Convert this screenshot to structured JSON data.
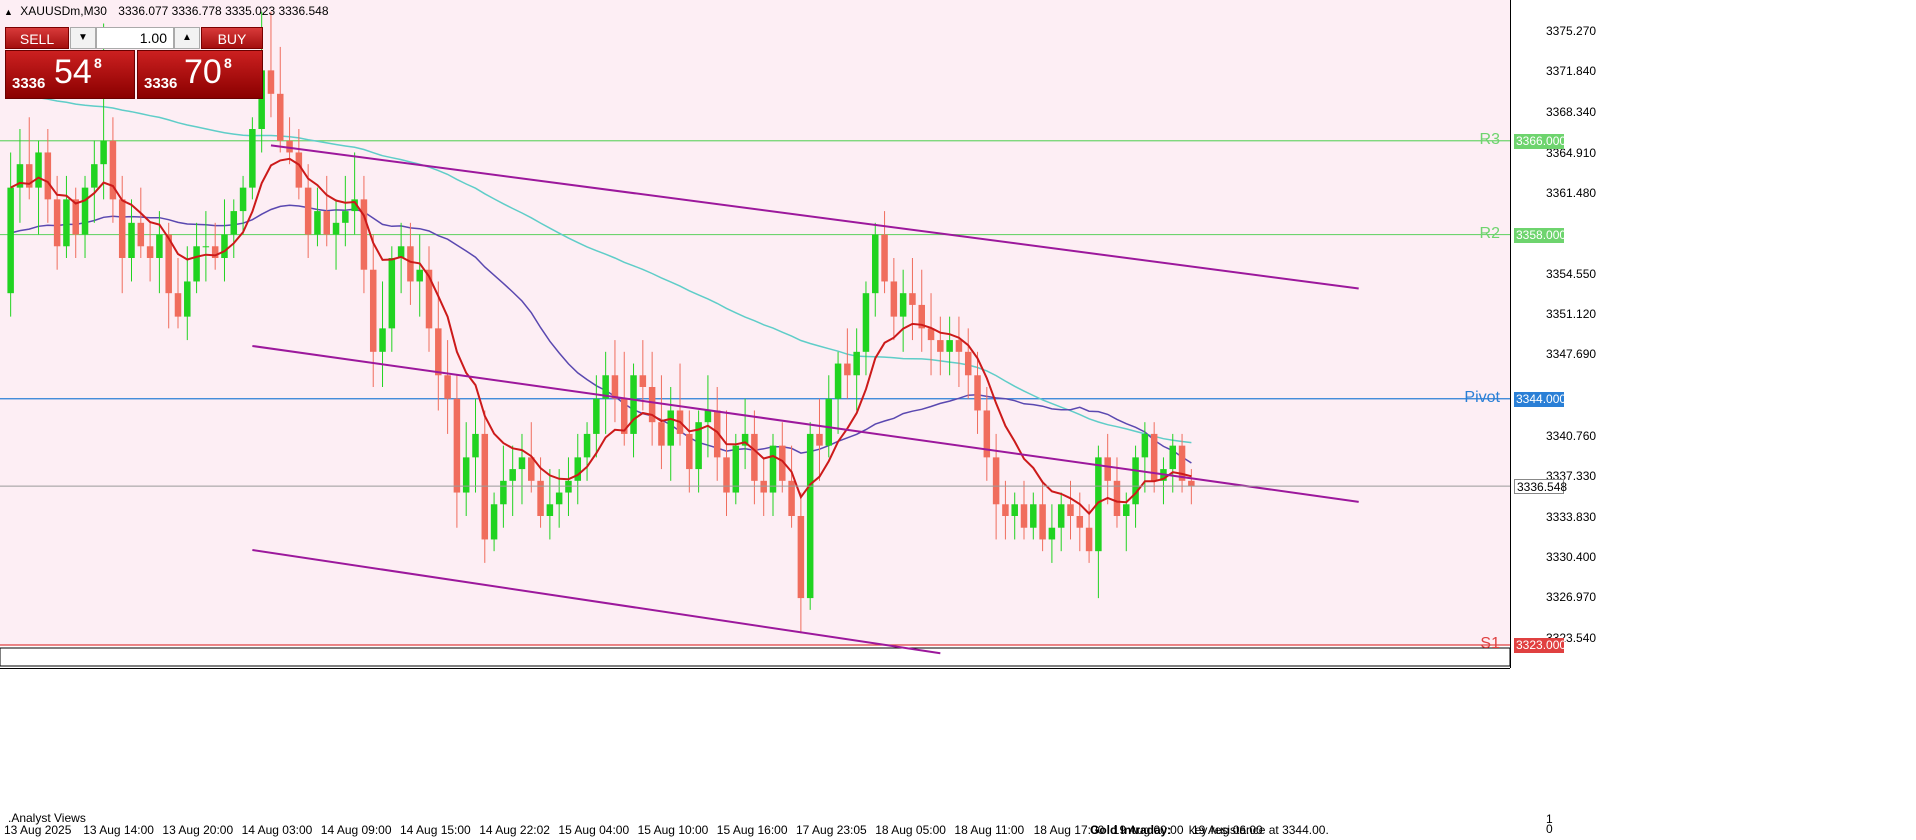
{
  "window": {
    "title": "XAUUSDm,M30",
    "ohlc": "3336.077 3336.778 3335.023 3336.548"
  },
  "trade_panel": {
    "sell_label": "SELL",
    "buy_label": "BUY",
    "lot_value": "1.00",
    "dec_symbol": "▼",
    "inc_symbol": "▲",
    "sell_price": {
      "prefix": "3336",
      "big": "54",
      "sup": "8"
    },
    "buy_price": {
      "prefix": "3336",
      "big": "70",
      "sup": "8"
    }
  },
  "colors": {
    "background": "#fdeef4",
    "bull": "#21d321",
    "bear": "#f06d5d",
    "ema_fast": "#cc1a1a",
    "ma_mid": "#5a48b0",
    "ma_slow": "#5fcdc8",
    "channel": "#9c189c",
    "resistance": "#6ed46e",
    "pivot": "#2a7fd6",
    "support": "#e04040"
  },
  "chart_data": {
    "type": "candlestick",
    "symbol": "XAUUSDm",
    "timeframe": "M30",
    "y_range": [
      3323.0,
      3378.0
    ],
    "y_ticks": [
      "3375.270",
      "3371.840",
      "3368.340",
      "3364.910",
      "3361.480",
      "3354.550",
      "3351.120",
      "3347.690",
      "3340.760",
      "3337.330",
      "3333.830",
      "3330.400",
      "3326.970",
      "3323.540"
    ],
    "x_ticks": [
      "13 Aug 2025",
      "13 Aug 14:00",
      "13 Aug 20:00",
      "14 Aug 03:00",
      "14 Aug 09:00",
      "14 Aug 15:00",
      "14 Aug 22:02",
      "15 Aug 04:00",
      "15 Aug 10:00",
      "15 Aug 16:00",
      "17 Aug 23:05",
      "18 Aug 05:00",
      "18 Aug 11:00",
      "18 Aug 17:00",
      "19 Aug 00:00",
      "19 Aug 06:00"
    ],
    "current_price": "3336.548",
    "levels": [
      {
        "name": "R3",
        "value": 3366.0,
        "label": "3366.000",
        "kind": "resistance"
      },
      {
        "name": "R2",
        "value": 3358.0,
        "label": "3358.000",
        "kind": "resistance"
      },
      {
        "name": "Pivot",
        "value": 3344.0,
        "label": "3344.000",
        "kind": "pivot"
      },
      {
        "name": "S1",
        "value": 3323.0,
        "label": "3323.000",
        "kind": "support"
      }
    ],
    "candles": [
      [
        3353,
        3365,
        3351,
        3362
      ],
      [
        3362,
        3367,
        3359,
        3364
      ],
      [
        3364,
        3368,
        3361,
        3362
      ],
      [
        3362,
        3366,
        3358,
        3365
      ],
      [
        3365,
        3367,
        3359,
        3361
      ],
      [
        3361,
        3363,
        3355,
        3357
      ],
      [
        3357,
        3363,
        3356,
        3361
      ],
      [
        3361,
        3362,
        3356,
        3358
      ],
      [
        3358,
        3363,
        3356,
        3362
      ],
      [
        3362,
        3366,
        3359,
        3364
      ],
      [
        3364,
        3376,
        3361,
        3366
      ],
      [
        3366,
        3368,
        3359,
        3361
      ],
      [
        3361,
        3363,
        3353,
        3356
      ],
      [
        3356,
        3361,
        3354,
        3359
      ],
      [
        3359,
        3362,
        3356,
        3357
      ],
      [
        3357,
        3359,
        3354,
        3356
      ],
      [
        3356,
        3360,
        3353,
        3358
      ],
      [
        3358,
        3359,
        3350,
        3353
      ],
      [
        3353,
        3356,
        3350,
        3351
      ],
      [
        3351,
        3357,
        3349,
        3354
      ],
      [
        3354,
        3359,
        3353,
        3357
      ],
      [
        3357,
        3360,
        3354,
        3357
      ],
      [
        3357,
        3359,
        3355,
        3356
      ],
      [
        3356,
        3361,
        3354,
        3358
      ],
      [
        3358,
        3361,
        3356,
        3360
      ],
      [
        3360,
        3363,
        3358,
        3362
      ],
      [
        3362,
        3368,
        3361,
        3367
      ],
      [
        3367,
        3377,
        3365,
        3372
      ],
      [
        3372,
        3377,
        3368,
        3370
      ],
      [
        3370,
        3374,
        3365,
        3366
      ],
      [
        3366,
        3368,
        3364,
        3365
      ],
      [
        3365,
        3367,
        3361,
        3362
      ],
      [
        3362,
        3364,
        3356,
        3358
      ],
      [
        3358,
        3362,
        3357,
        3360
      ],
      [
        3360,
        3363,
        3357,
        3358
      ],
      [
        3358,
        3361,
        3355,
        3359
      ],
      [
        3359,
        3363,
        3357,
        3360
      ],
      [
        3360,
        3365,
        3358,
        3361
      ],
      [
        3361,
        3363,
        3353,
        3355
      ],
      [
        3355,
        3358,
        3345,
        3348
      ],
      [
        3348,
        3354,
        3345,
        3350
      ],
      [
        3350,
        3357,
        3348,
        3356
      ],
      [
        3356,
        3359,
        3353,
        3357
      ],
      [
        3357,
        3359,
        3352,
        3354
      ],
      [
        3354,
        3358,
        3351,
        3355
      ],
      [
        3355,
        3357,
        3348,
        3350
      ],
      [
        3350,
        3354,
        3343,
        3346
      ],
      [
        3346,
        3349,
        3341,
        3344
      ],
      [
        3344,
        3346,
        3333,
        3336
      ],
      [
        3336,
        3342,
        3334,
        3339
      ],
      [
        3339,
        3344,
        3336,
        3341
      ],
      [
        3341,
        3343,
        3330,
        3332
      ],
      [
        3332,
        3336,
        3331,
        3335
      ],
      [
        3335,
        3340,
        3333,
        3337
      ],
      [
        3337,
        3340,
        3334,
        3338
      ],
      [
        3338,
        3341,
        3335,
        3339
      ],
      [
        3339,
        3342,
        3336,
        3337
      ],
      [
        3337,
        3339,
        3333,
        3334
      ],
      [
        3334,
        3338,
        3332,
        3335
      ],
      [
        3335,
        3338,
        3333,
        3336
      ],
      [
        3336,
        3339,
        3334,
        3337
      ],
      [
        3337,
        3341,
        3335,
        3339
      ],
      [
        3339,
        3342,
        3337,
        3341
      ],
      [
        3341,
        3346,
        3339,
        3344
      ],
      [
        3344,
        3348,
        3341,
        3346
      ],
      [
        3346,
        3349,
        3342,
        3344
      ],
      [
        3344,
        3348,
        3340,
        3341
      ],
      [
        3341,
        3347,
        3339,
        3346
      ],
      [
        3346,
        3349,
        3343,
        3345
      ],
      [
        3345,
        3348,
        3340,
        3342
      ],
      [
        3342,
        3346,
        3338,
        3340
      ],
      [
        3340,
        3345,
        3337,
        3343
      ],
      [
        3343,
        3347,
        3340,
        3341
      ],
      [
        3341,
        3343,
        3336,
        3338
      ],
      [
        3338,
        3343,
        3336,
        3342
      ],
      [
        3342,
        3346,
        3339,
        3343
      ],
      [
        3343,
        3345,
        3337,
        3339
      ],
      [
        3339,
        3343,
        3334,
        3336
      ],
      [
        3336,
        3341,
        3335,
        3340
      ],
      [
        3340,
        3344,
        3338,
        3341
      ],
      [
        3341,
        3343,
        3335,
        3337
      ],
      [
        3337,
        3339,
        3334,
        3336
      ],
      [
        3336,
        3341,
        3334,
        3340
      ],
      [
        3340,
        3342,
        3336,
        3337
      ],
      [
        3337,
        3340,
        3333,
        3334
      ],
      [
        3334,
        3336,
        3324,
        3327
      ],
      [
        3327,
        3342,
        3326,
        3341
      ],
      [
        3341,
        3344,
        3337,
        3340
      ],
      [
        3340,
        3346,
        3339,
        3344
      ],
      [
        3344,
        3348,
        3341,
        3347
      ],
      [
        3347,
        3350,
        3344,
        3346
      ],
      [
        3346,
        3350,
        3343,
        3348
      ],
      [
        3348,
        3354,
        3346,
        3353
      ],
      [
        3353,
        3359,
        3351,
        3358
      ],
      [
        3358,
        3360,
        3353,
        3354
      ],
      [
        3354,
        3356,
        3349,
        3351
      ],
      [
        3351,
        3355,
        3348,
        3353
      ],
      [
        3353,
        3356,
        3349,
        3352
      ],
      [
        3352,
        3355,
        3348,
        3350
      ],
      [
        3350,
        3353,
        3346,
        3349
      ],
      [
        3349,
        3351,
        3346,
        3348
      ],
      [
        3348,
        3351,
        3346,
        3349
      ],
      [
        3349,
        3351,
        3345,
        3348
      ],
      [
        3348,
        3350,
        3344,
        3346
      ],
      [
        3346,
        3348,
        3341,
        3343
      ],
      [
        3343,
        3345,
        3337,
        3339
      ],
      [
        3339,
        3341,
        3332,
        3335
      ],
      [
        3335,
        3337,
        3332,
        3334
      ],
      [
        3334,
        3336,
        3332,
        3335
      ],
      [
        3335,
        3337,
        3332,
        3333
      ],
      [
        3333,
        3336,
        3332,
        3335
      ],
      [
        3335,
        3337,
        3331,
        3332
      ],
      [
        3332,
        3335,
        3330,
        3333
      ],
      [
        3333,
        3336,
        3331,
        3335
      ],
      [
        3335,
        3337,
        3332,
        3334
      ],
      [
        3334,
        3336,
        3331,
        3333
      ],
      [
        3333,
        3335,
        3330,
        3331
      ],
      [
        3331,
        3340,
        3327,
        3339
      ],
      [
        3339,
        3341,
        3335,
        3337
      ],
      [
        3337,
        3339,
        3333,
        3334
      ],
      [
        3334,
        3336,
        3331,
        3335
      ],
      [
        3335,
        3340,
        3333,
        3339
      ],
      [
        3339,
        3342,
        3336,
        3341
      ],
      [
        3341,
        3342,
        3336,
        3337
      ],
      [
        3337,
        3339,
        3335,
        3338
      ],
      [
        3338,
        3341,
        3336,
        3340
      ],
      [
        3340,
        3341,
        3336,
        3337
      ],
      [
        3337,
        3338,
        3335,
        3336.548
      ]
    ]
  },
  "panel": {
    "label": ".Analyst Views"
  },
  "news": {
    "title": "Gold Intraday:",
    "text": "key resistance at 3344.00."
  },
  "scale": {
    "top": "1",
    "bottom": "0"
  }
}
